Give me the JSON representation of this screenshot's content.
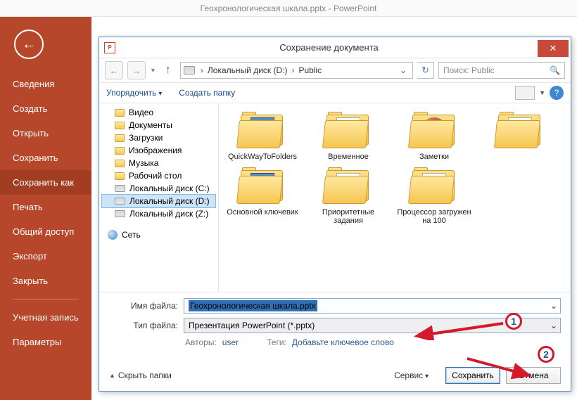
{
  "window_title": "Геохронологическая шкала.pptx - PowerPoint",
  "sidebar": {
    "items": [
      {
        "label": "Сведения"
      },
      {
        "label": "Создать"
      },
      {
        "label": "Открыть"
      },
      {
        "label": "Сохранить"
      },
      {
        "label": "Сохранить как"
      },
      {
        "label": "Печать"
      },
      {
        "label": "Общий доступ"
      },
      {
        "label": "Экспорт"
      },
      {
        "label": "Закрыть"
      }
    ],
    "footer": [
      {
        "label": "Учетная запись"
      },
      {
        "label": "Параметры"
      }
    ]
  },
  "dialog": {
    "title": "Сохранение документа",
    "icon_letter": "P",
    "breadcrumbs": [
      {
        "label": "Локальный диск (D:)"
      },
      {
        "label": "Public"
      }
    ],
    "search_placeholder": "Поиск: Public",
    "toolbar": {
      "organize": "Упорядочить",
      "new_folder": "Создать папку"
    },
    "tree": [
      {
        "icon": "folder",
        "label": "Видео"
      },
      {
        "icon": "folder",
        "label": "Документы"
      },
      {
        "icon": "folder",
        "label": "Загрузки"
      },
      {
        "icon": "folder",
        "label": "Изображения"
      },
      {
        "icon": "folder",
        "label": "Музыка"
      },
      {
        "icon": "folder",
        "label": "Рабочий стол"
      },
      {
        "icon": "drive",
        "label": "Локальный диск (C:)"
      },
      {
        "icon": "drive",
        "label": "Локальный диск (D:)",
        "selected": true
      },
      {
        "icon": "drive",
        "label": "Локальный диск (Z:)"
      },
      {
        "icon": "net",
        "label": "Сеть"
      }
    ],
    "files": [
      {
        "label": "QuickWayToFolders",
        "inner": "blue"
      },
      {
        "label": "Временное",
        "inner": "img"
      },
      {
        "label": "Заметки",
        "inner": "cd"
      },
      {
        "label": "",
        "inner": "note"
      },
      {
        "label": "Основной ключевик",
        "inner": "blue"
      },
      {
        "label": "Приоритетные задания",
        "inner": "img"
      },
      {
        "label": "Процессор загружен на 100",
        "inner": "red"
      }
    ],
    "form": {
      "filename_label": "Имя файла:",
      "filename_value": "Геохронологическая шкала.pptx",
      "filetype_label": "Тип файла:",
      "filetype_value": "Презентация PowerPoint (*.pptx)",
      "author_label": "Авторы:",
      "author_value": "user",
      "tags_label": "Теги:",
      "tags_value": "Добавьте ключевое слово"
    },
    "footer": {
      "hide_folders": "Скрыть папки",
      "service": "Сервис",
      "save": "Сохранить",
      "cancel": "Отмена"
    }
  },
  "annotations": {
    "one": "1",
    "two": "2"
  }
}
